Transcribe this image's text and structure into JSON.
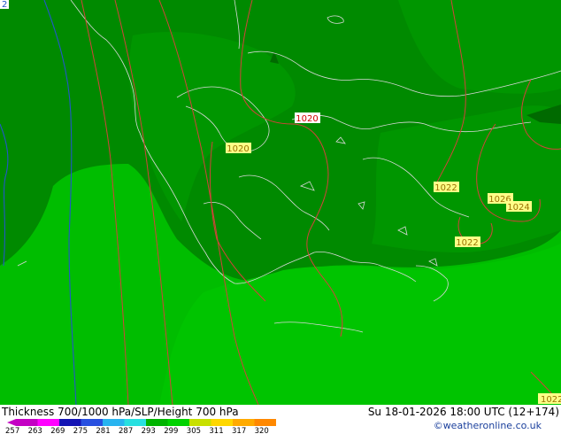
{
  "title": "Thickness 700/1000 hPa/SLP/Height 700 hPa",
  "datetime": "Su 18-01-2026 18:00 UTC (12+174)",
  "credit": "©weatheronline.co.uk",
  "colors": {
    "land_dark": "#008a00",
    "land_mid": "#00a000",
    "field_light": "#00bd00",
    "field_lighter": "#00c800",
    "isobar": "#d2433a",
    "coast": "#d8d8d8",
    "contour_blue": "#2256c8"
  },
  "isobar_labels": [
    {
      "id": "1020-north",
      "text": "1020",
      "color": "#d20000"
    },
    {
      "id": "1020-west",
      "text": "1020",
      "color": "#9a7000"
    },
    {
      "id": "1022-east",
      "text": "1022",
      "color": "#9a7000"
    },
    {
      "id": "1026-east",
      "text": "1026",
      "color": "#9a7000"
    },
    {
      "id": "1024-east",
      "text": "1024",
      "color": "#9a7000"
    },
    {
      "id": "1022-south",
      "text": "1022",
      "color": "#9a7000"
    },
    {
      "id": "1022-corner",
      "text": "1022",
      "color": "#9a7000"
    }
  ],
  "corner_label": "2",
  "legend": {
    "values": [
      "257",
      "263",
      "269",
      "275",
      "281",
      "287",
      "293",
      "299",
      "305",
      "311",
      "317",
      "320"
    ],
    "colors": [
      "#c400c4",
      "#ff00ff",
      "#1414b4",
      "#2850e0",
      "#28b4f0",
      "#28e0e0",
      "#00b400",
      "#00d200",
      "#c8e000",
      "#ffd700",
      "#ffaa00",
      "#ff8800"
    ]
  }
}
